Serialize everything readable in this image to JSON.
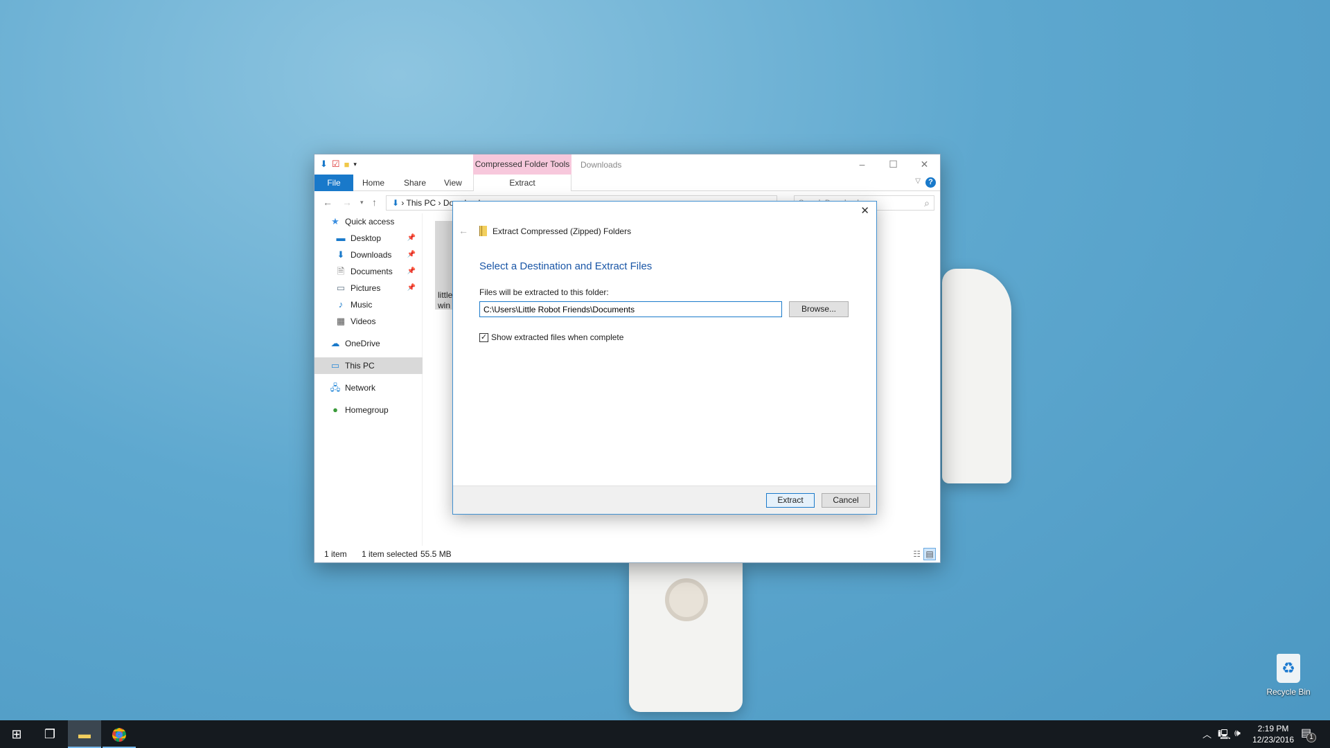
{
  "desktop": {
    "recycle_bin_label": "Recycle Bin"
  },
  "explorer": {
    "title": "Downloads",
    "context_tab_group": "Compressed Folder Tools",
    "tabs": [
      "File",
      "Home",
      "Share",
      "View",
      "Extract"
    ],
    "breadcrumb": [
      "This PC",
      "Downloads"
    ],
    "search_placeholder": "Search Downloads",
    "sidebar": [
      {
        "label": "Quick access",
        "icon": "star-icon"
      },
      {
        "label": "Desktop",
        "icon": "desktop-icon",
        "pinned": true
      },
      {
        "label": "Downloads",
        "icon": "download-icon",
        "pinned": true
      },
      {
        "label": "Documents",
        "icon": "document-icon",
        "pinned": true
      },
      {
        "label": "Pictures",
        "icon": "picture-icon",
        "pinned": true
      },
      {
        "label": "Music",
        "icon": "music-icon"
      },
      {
        "label": "Videos",
        "icon": "video-icon"
      },
      {
        "label": "OneDrive",
        "icon": "cloud-icon"
      },
      {
        "label": "This PC",
        "icon": "computer-icon",
        "selected": true
      },
      {
        "label": "Network",
        "icon": "network-icon"
      },
      {
        "label": "Homegroup",
        "icon": "homegroup-icon"
      }
    ],
    "file_item": {
      "label_line1": "little",
      "label_line2": "win"
    },
    "status": {
      "count": "1 item",
      "selected": "1 item selected",
      "size": "55.5 MB"
    }
  },
  "dialog": {
    "title": "Extract Compressed (Zipped) Folders",
    "heading": "Select a Destination and Extract Files",
    "folder_label": "Files will be extracted to this folder:",
    "folder_value": "C:\\Users\\Little Robot Friends\\Documents",
    "browse": "Browse...",
    "show_files_label": "Show extracted files when complete",
    "show_files_checked": true,
    "extract": "Extract",
    "cancel": "Cancel",
    "accent": "#1a56a6"
  },
  "taskbar": {
    "time": "2:19 PM",
    "date": "12/23/2016",
    "notifications": "1"
  }
}
